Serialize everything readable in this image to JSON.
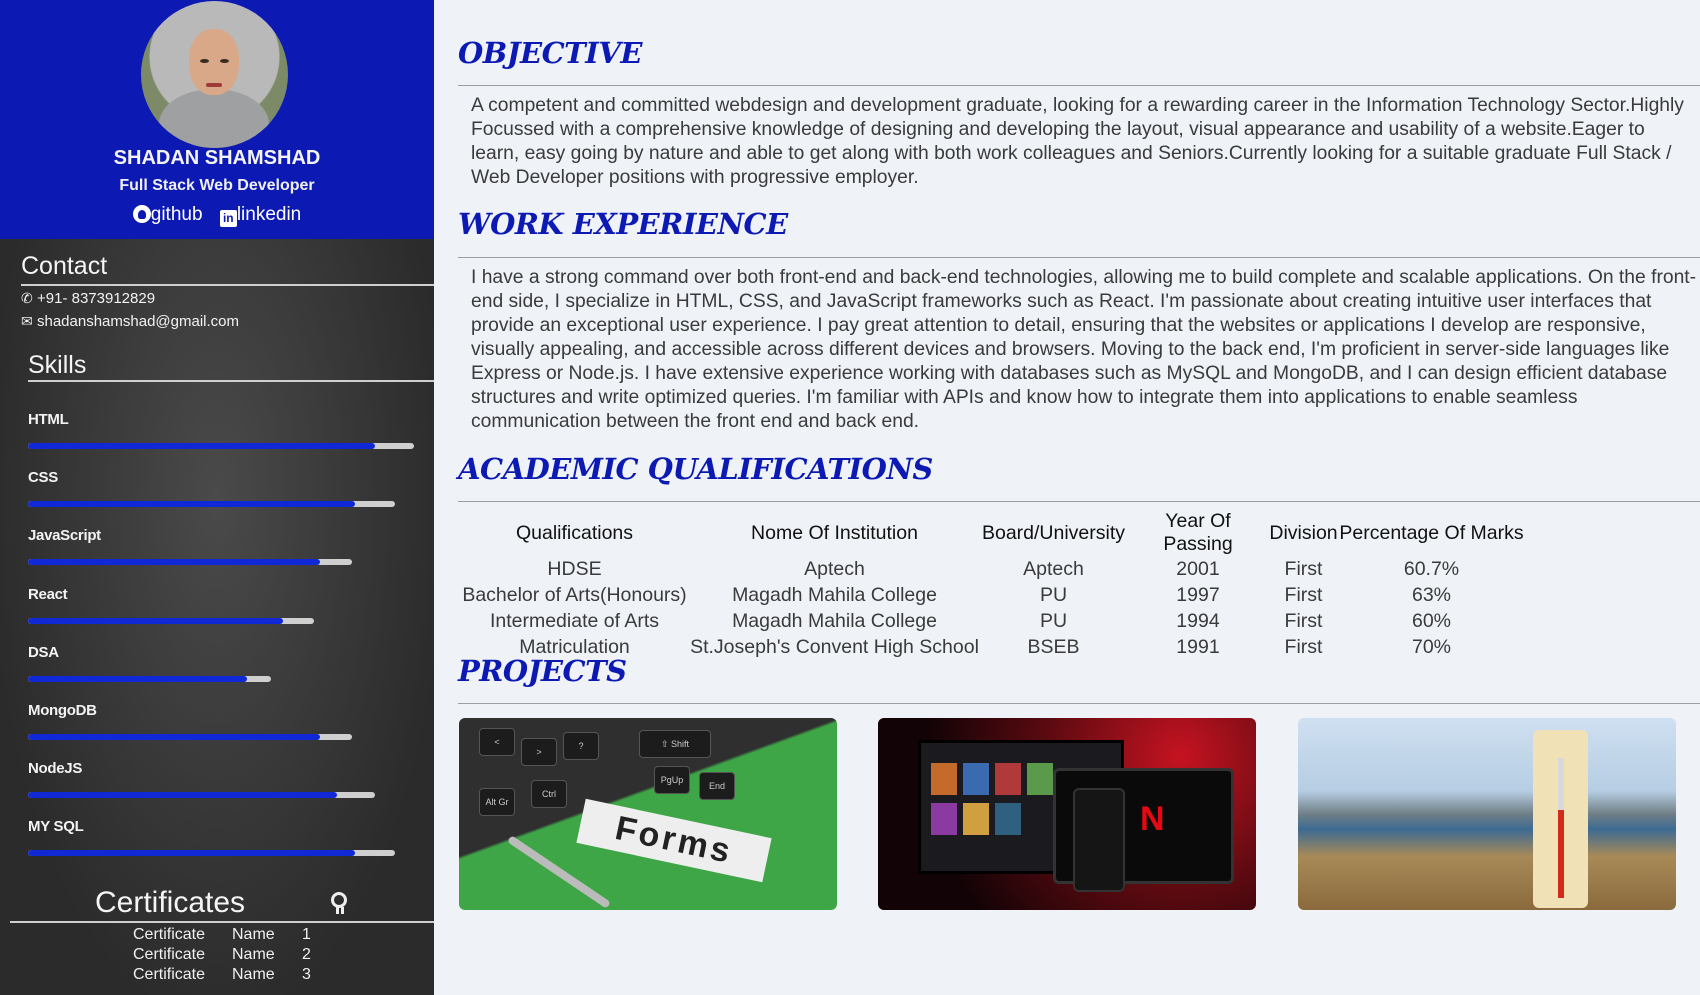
{
  "profile": {
    "name": "SHADAN SHAMSHAD",
    "role": "Full Stack Web Developer",
    "github_label": "github",
    "linkedin_label": "linkedin"
  },
  "contact": {
    "heading": "Contact",
    "phone": "+91- 8373912829",
    "email": "shadanshamshad@gmail.com"
  },
  "skills": {
    "heading": "Skills",
    "items": [
      {
        "label": "HTML",
        "level": 0.9,
        "track": 1.0
      },
      {
        "label": "CSS",
        "level": 0.85,
        "track": 0.95
      },
      {
        "label": "JavaScript",
        "level": 0.76,
        "track": 0.84
      },
      {
        "label": "React",
        "level": 0.66,
        "track": 0.74
      },
      {
        "label": "DSA",
        "level": 0.57,
        "track": 0.63
      },
      {
        "label": "MongoDB",
        "level": 0.76,
        "track": 0.84
      },
      {
        "label": "NodeJS",
        "level": 0.8,
        "track": 0.9
      },
      {
        "label": "MY SQL",
        "level": 0.85,
        "track": 0.95
      }
    ]
  },
  "certificates": {
    "heading": "Certificates",
    "rows": [
      [
        "Certificate",
        "Name",
        "1"
      ],
      [
        "Certificate",
        "Name",
        "2"
      ],
      [
        "Certificate",
        "Name",
        "3"
      ]
    ]
  },
  "objective": {
    "heading": "OBJECTIVE",
    "text": "A competent and committed webdesign and development graduate, looking for a rewarding career in the Information Technology Sector.Highly Focussed with a comprehensive knowledge of designing and developing the layout, visual appearance and usability of a website.Eager to learn, easy going by nature and able to get along with both work colleagues and Seniors.Currently looking for a suitable graduate Full Stack / Web Developer positions with progressive employer."
  },
  "experience": {
    "heading": "WORK EXPERIENCE",
    "text": "I have a strong command over both front-end and back-end technologies, allowing me to build complete and scalable applications. On the front-end side, I specialize in HTML, CSS, and JavaScript frameworks such as React. I'm passionate about creating intuitive user interfaces that provide an exceptional user experience. I pay great attention to detail, ensuring that the websites or applications I develop are responsive, visually appealing, and accessible across different devices and browsers. Moving to the back end, I'm proficient in server-side languages like Express or Node.js. I have extensive experience working with databases such as MySQL and MongoDB, and I can design efficient database structures and write optimized queries. I'm familiar with APIs and know how to integrate them into applications to enable seamless communication between the front end and back end."
  },
  "academic": {
    "heading": "ACADEMIC QUALIFICATIONS",
    "columns": [
      "Qualifications",
      "Nome Of Institution",
      "Board/University",
      "Year Of Passing",
      "Division",
      "Percentage Of Marks"
    ],
    "rows": [
      [
        "HDSE",
        "Aptech",
        "Aptech",
        "2001",
        "First",
        "60.7%"
      ],
      [
        "Bachelor of Arts(Honours)",
        "Magadh Mahila College",
        "PU",
        "1997",
        "First",
        "63%"
      ],
      [
        "Intermediate of Arts",
        "Magadh Mahila College",
        "PU",
        "1994",
        "First",
        "60%"
      ],
      [
        "Matriculation",
        "St.Joseph's Convent High School",
        "BSEB",
        "1991",
        "First",
        "70%"
      ]
    ]
  },
  "projects": {
    "heading": "PROJECTS",
    "items": [
      {
        "image": "forms-keyboard-photo",
        "caption": "Forms"
      },
      {
        "image": "netflix-devices-photo",
        "caption": "N"
      },
      {
        "image": "thermometer-landscape-photo",
        "caption": ""
      }
    ]
  },
  "colors": {
    "accent": "#0c19b3",
    "sidebar_bg": "#2e2e2e",
    "skill_fill": "#1028d6",
    "page_bg": "#eff3f8"
  }
}
